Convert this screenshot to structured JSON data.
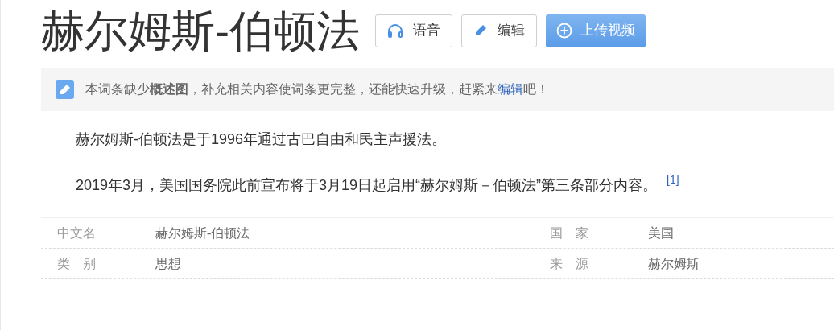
{
  "title": "赫尔姆斯-伯顿法",
  "buttons": [
    {
      "kind": "audio",
      "label": "语音"
    },
    {
      "kind": "edit",
      "label": "编辑"
    },
    {
      "kind": "upload",
      "label": "上传视频"
    }
  ],
  "notice": {
    "text": "本词条缺少**概述图**，补充相关内容使词条更完整，还能快速升级，赶紧来",
    "link": "编辑",
    "suffix": "吧！"
  },
  "paragraphs": [
    {
      "text": "赫尔姆斯-伯顿法是于1996年通过古巴自由和民主声援法。"
    },
    {
      "text": "2019年3月，美国国务院此前宣布将于3月19日起启用“赫尔姆斯－伯顿法”第三条部分内容。",
      "ref": "[1]"
    }
  ],
  "info_rows": [
    [
      {
        "label": "中文名",
        "value": "赫尔姆斯-伯顿法"
      },
      {
        "label": "国　家",
        "value": "美国"
      }
    ],
    [
      {
        "label": "类　别",
        "value": "思想"
      },
      {
        "label": "来　源",
        "value": "赫尔姆斯"
      }
    ]
  ]
}
